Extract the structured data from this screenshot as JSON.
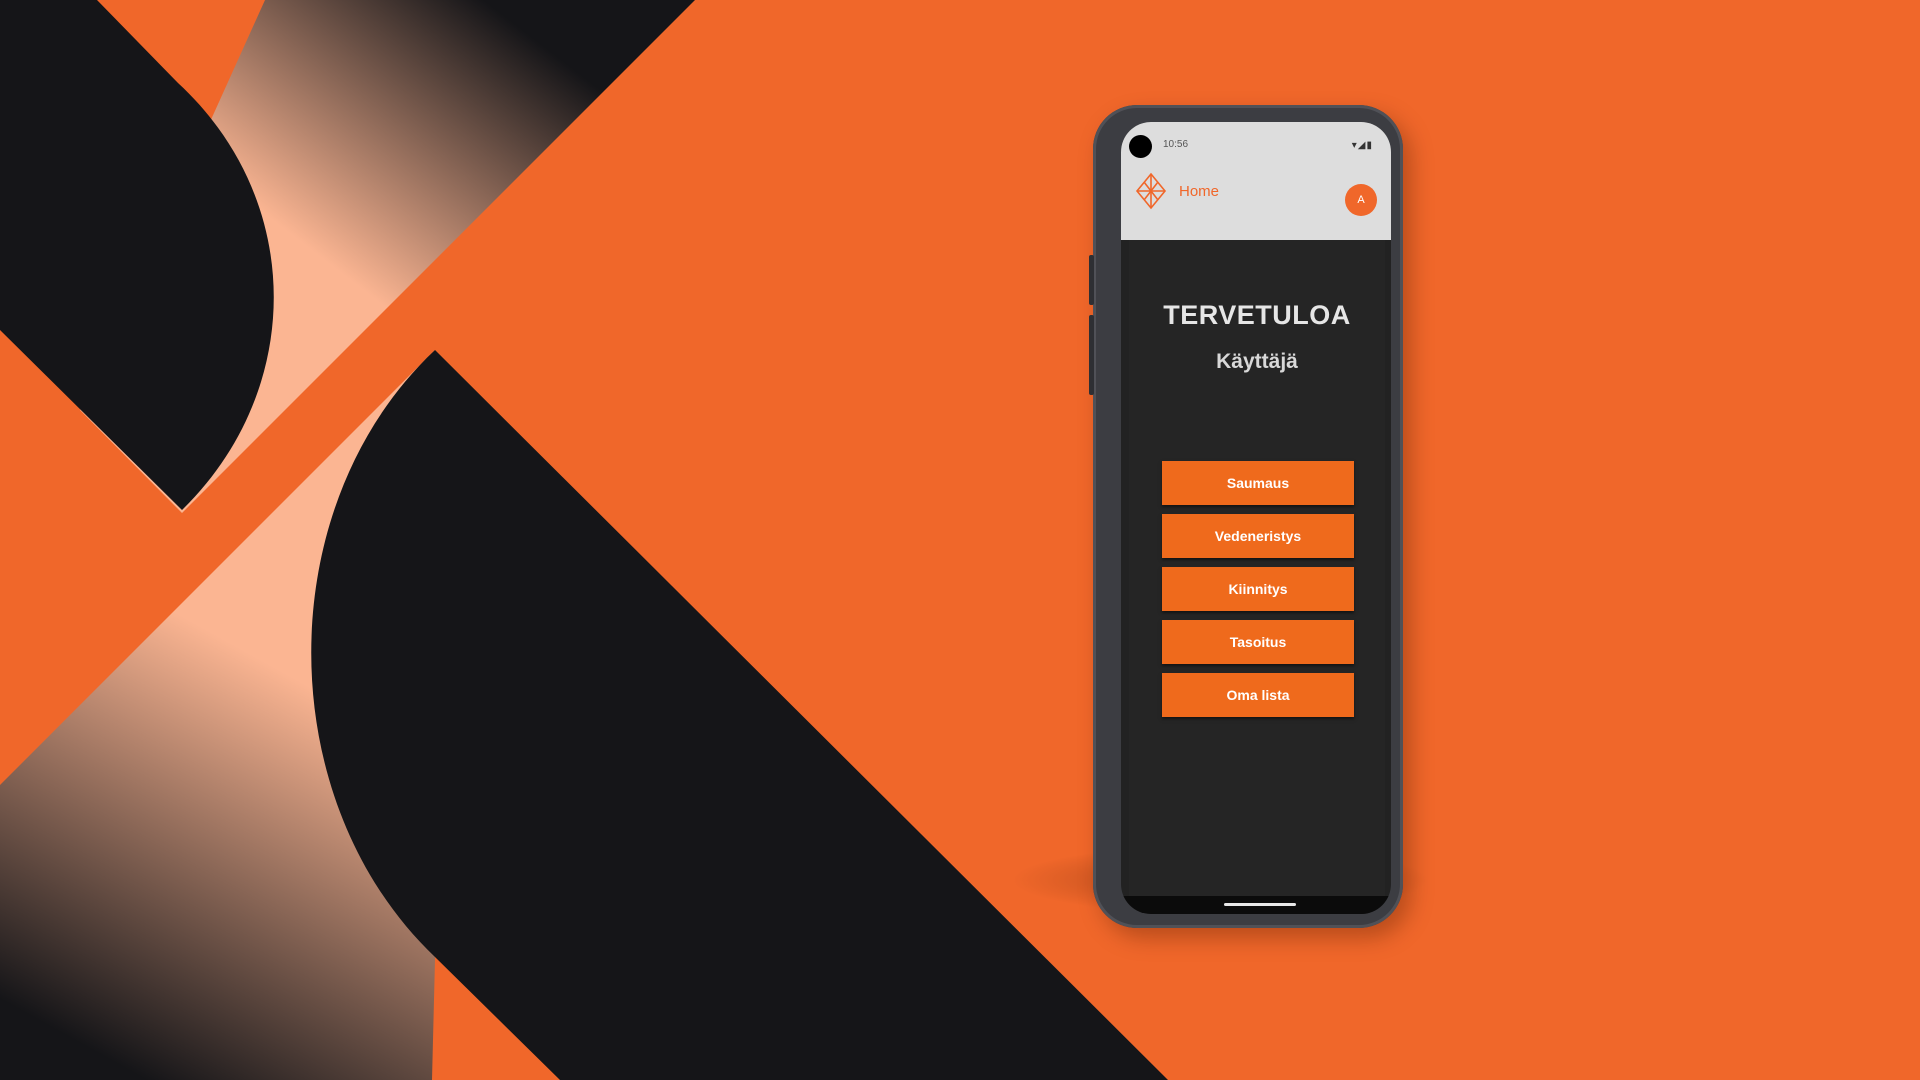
{
  "colors": {
    "accent": "#f0672a",
    "background_orange": "#f0672a",
    "shape_dark": "#151518",
    "gradient_peach": "#fbb592",
    "screen_dark": "#252525",
    "topbar_light": "#dddddd"
  },
  "status_bar": {
    "time": "10:56",
    "icons": "▾◢▮"
  },
  "app_bar": {
    "logo_icon": "diamond-lattice-logo",
    "title": "Home",
    "avatar_letter": "A"
  },
  "welcome": {
    "title": "TERVETULOA",
    "username": "Käyttäjä"
  },
  "menu": [
    {
      "label": "Saumaus"
    },
    {
      "label": "Vedeneristys"
    },
    {
      "label": "Kiinnitys"
    },
    {
      "label": "Tasoitus"
    },
    {
      "label": "Oma lista"
    }
  ]
}
